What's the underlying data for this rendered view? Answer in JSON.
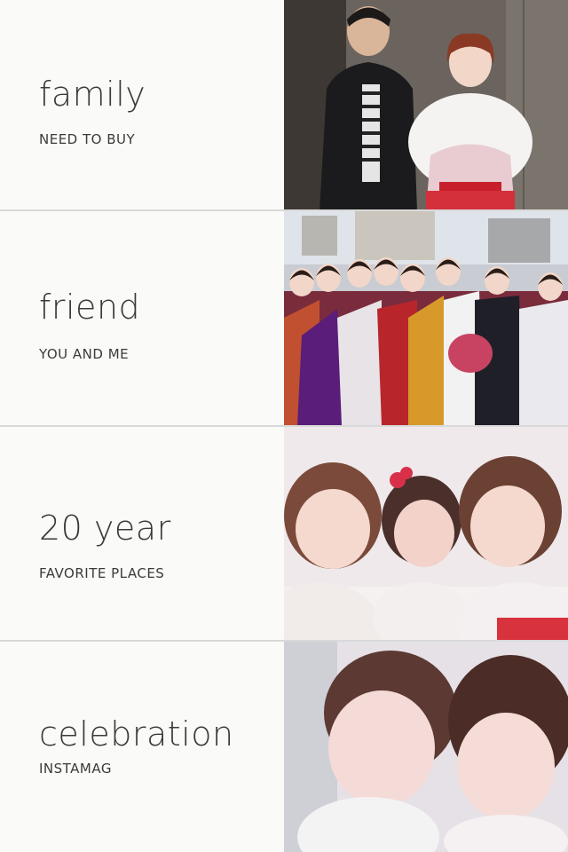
{
  "rows": [
    {
      "title": "family",
      "subtitle": "NEED TO BUY"
    },
    {
      "title": "friend",
      "subtitle": "YOU AND ME"
    },
    {
      "title": "20 year",
      "subtitle": "FAVORITE PLACES"
    },
    {
      "title": "celebration",
      "subtitle": "INSTAMAG"
    }
  ],
  "photo_icons": [
    "family-photo",
    "friends-group-photo",
    "selfie-trio-photo",
    "selfie-duo-photo"
  ]
}
